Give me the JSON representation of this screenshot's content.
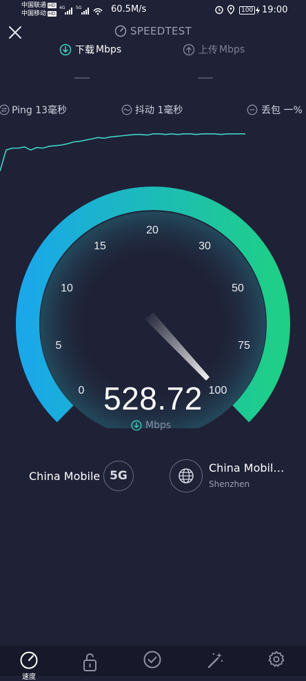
{
  "status_bar": {
    "carrier1": "中国联通",
    "carrier2": "中国移动",
    "hd_label": "HD",
    "net_badge": "4G",
    "net_badge2": "5G",
    "net_speed": "60.5M/s",
    "battery": "100",
    "time": "19:00"
  },
  "header": {
    "title": "SPEEDTEST",
    "tabs": [
      {
        "label": "下载",
        "unit": "Mbps",
        "value": "—",
        "active": true
      },
      {
        "label": "上传",
        "unit": "Mbps",
        "value": "—",
        "active": false
      }
    ]
  },
  "metrics": {
    "ping": "Ping 13毫秒",
    "jitter": "抖动  1毫秒",
    "loss": "丢包 一%"
  },
  "chart_data": {
    "type": "line",
    "x": [
      0,
      1,
      2,
      3,
      4,
      5,
      6,
      7,
      8,
      9,
      10,
      11,
      12,
      13,
      14,
      15,
      16,
      17,
      18,
      19,
      20,
      21,
      22,
      23,
      24,
      25,
      26,
      27,
      28,
      29,
      30,
      31,
      32,
      33,
      34,
      35,
      36,
      37,
      38,
      39,
      40
    ],
    "series": [
      {
        "values": [
          0.08,
          0.42,
          0.45,
          0.45,
          0.47,
          0.42,
          0.46,
          0.45,
          0.48,
          0.49,
          0.5,
          0.52,
          0.55,
          0.56,
          0.58,
          0.6,
          0.62,
          0.61,
          0.63,
          0.64,
          0.65,
          0.66,
          0.67,
          0.67,
          0.66,
          0.68,
          0.68,
          0.67,
          0.68,
          0.67,
          0.68,
          0.68,
          0.67,
          0.68,
          0.68,
          0.68,
          0.67,
          0.68,
          0.68,
          0.68,
          0.68
        ]
      }
    ],
    "color": "#3fd6c3"
  },
  "gauge": {
    "ticks": [
      "0",
      "5",
      "10",
      "15",
      "20",
      "30",
      "50",
      "75",
      "100"
    ],
    "needle_value": "100",
    "value": "528.72",
    "unit": "Mbps",
    "gradient_start": "#1aa8e8",
    "gradient_end": "#1fcf87"
  },
  "isp": {
    "name": "China Mobile",
    "badge": "5G"
  },
  "server": {
    "name": "China Mobil…",
    "city": "Shenzhen"
  },
  "nav": {
    "items": [
      {
        "icon": "speedometer-icon",
        "label": "速度",
        "active": true
      },
      {
        "icon": "vpn-lock-icon",
        "label": "",
        "active": false
      },
      {
        "icon": "check-circle-icon",
        "label": "",
        "active": false
      },
      {
        "icon": "magic-wand-icon",
        "label": "",
        "active": false
      },
      {
        "icon": "settings-icon",
        "label": "",
        "active": false
      }
    ]
  }
}
